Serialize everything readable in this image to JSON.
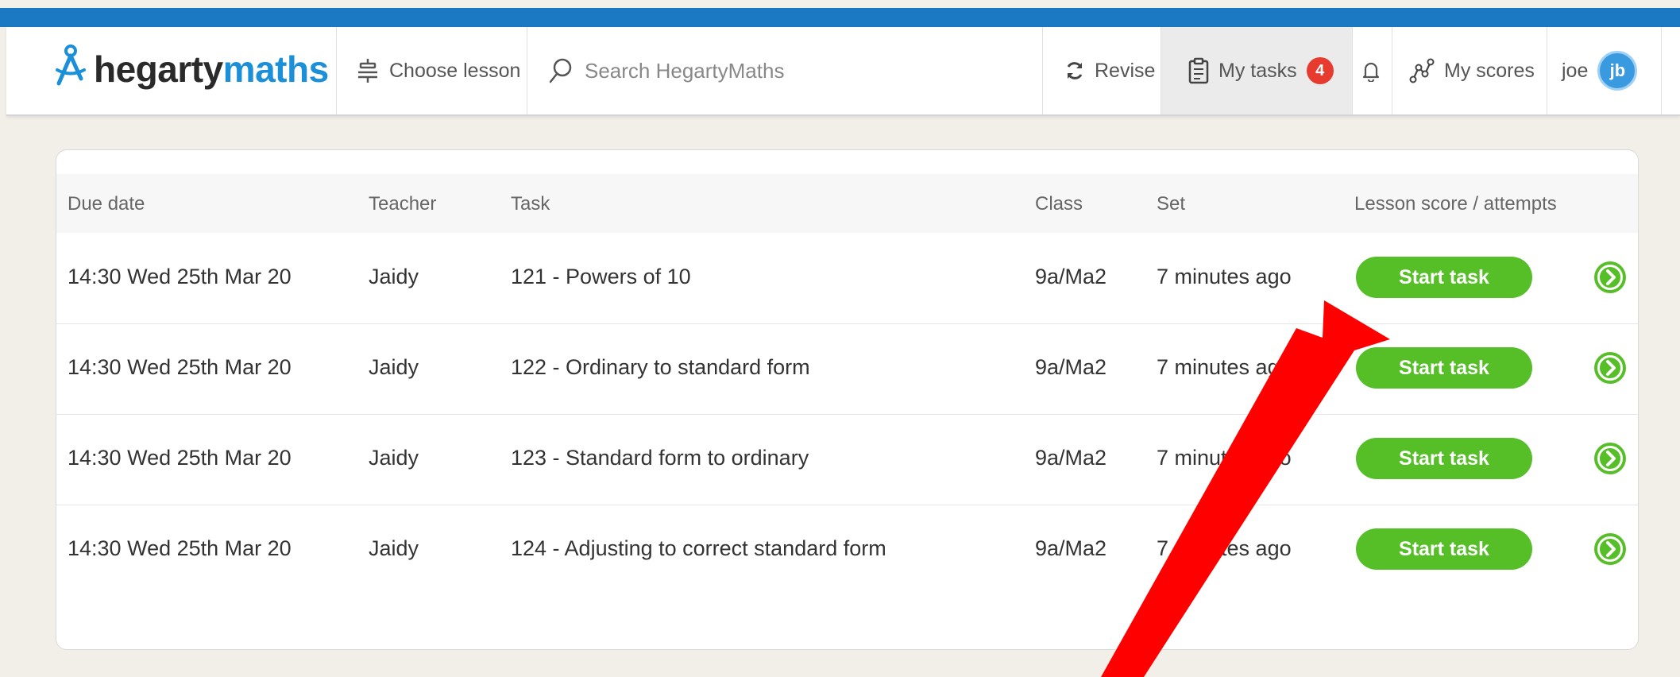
{
  "brand": {
    "logo_part1": "hegarty",
    "logo_part2": "maths",
    "primary_color": "#1b78c2",
    "accent_color": "#56bf28"
  },
  "nav": {
    "choose_lesson": "Choose lesson",
    "search_placeholder": "Search HegartyMaths",
    "revise": "Revise",
    "my_tasks": "My tasks",
    "my_tasks_count": "4",
    "my_scores": "My scores",
    "user_name": "joe",
    "user_initials": "jb"
  },
  "table": {
    "headers": {
      "due_date": "Due date",
      "teacher": "Teacher",
      "task": "Task",
      "class": "Class",
      "set": "Set",
      "score": "Lesson score / attempts"
    },
    "rows": [
      {
        "due_date": "14:30 Wed 25th Mar 20",
        "teacher": "Jaidy",
        "task": "121 - Powers of 10",
        "class": "9a/Ma2",
        "set": "7 minutes ago",
        "action": "Start task"
      },
      {
        "due_date": "14:30 Wed 25th Mar 20",
        "teacher": "Jaidy",
        "task": "122 - Ordinary to standard form",
        "class": "9a/Ma2",
        "set": "7 minutes ago",
        "action": "Start task"
      },
      {
        "due_date": "14:30 Wed 25th Mar 20",
        "teacher": "Jaidy",
        "task": "123 - Standard form to ordinary",
        "class": "9a/Ma2",
        "set": "7 minutes ago",
        "action": "Start task"
      },
      {
        "due_date": "14:30 Wed 25th Mar 20",
        "teacher": "Jaidy",
        "task": "124 - Adjusting to correct standard form",
        "class": "9a/Ma2",
        "set": "7 minutes ago",
        "action": "Start task"
      }
    ]
  },
  "annotation": {
    "arrow_color": "#ff0000",
    "arrow_icon": "red-pointer-arrow"
  }
}
